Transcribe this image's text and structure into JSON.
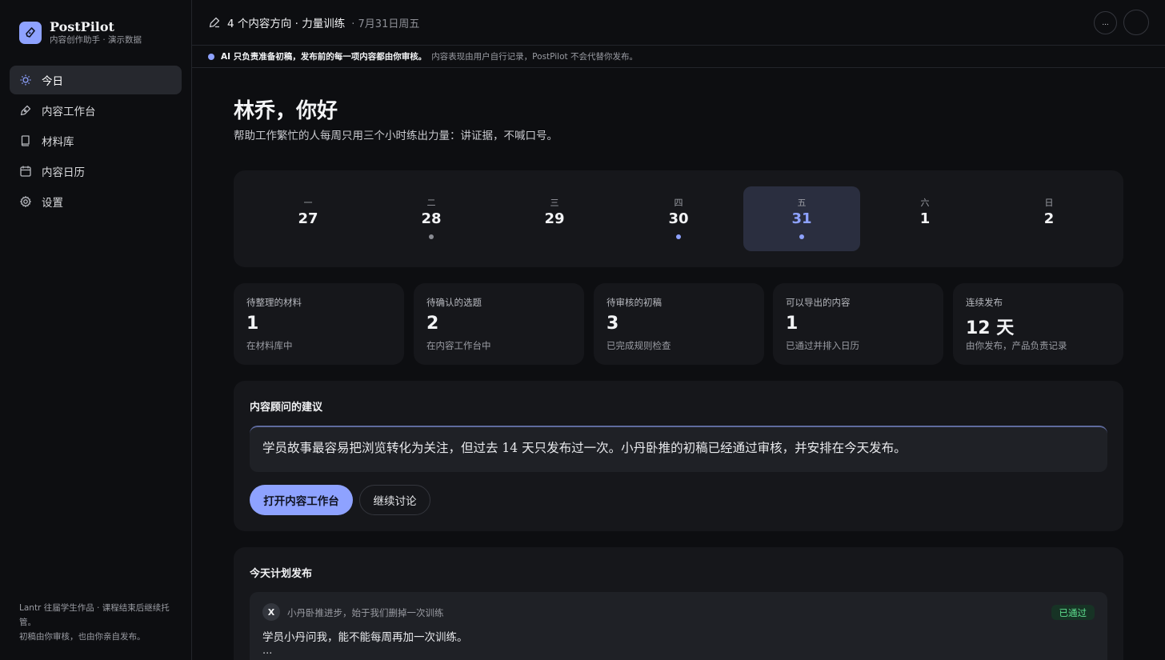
{
  "app": {
    "name": "PostPilot",
    "subtitle": "内容创作助手 · 演示数据"
  },
  "nav": [
    {
      "label": "今日",
      "icon": "sun-icon",
      "active": true
    },
    {
      "label": "内容工作台",
      "icon": "pen-icon",
      "active": false
    },
    {
      "label": "材料库",
      "icon": "book-icon",
      "active": false
    },
    {
      "label": "内容日历",
      "icon": "calendar-icon",
      "active": false
    },
    {
      "label": "设置",
      "icon": "gear-icon",
      "active": false
    }
  ],
  "sidebar_footer": {
    "line1": "Lantr 往届学生作品 · 课程结束后继续托管。",
    "line2": "初稿由你审核，也由你亲自发布。"
  },
  "topbar": {
    "title": "4 个内容方向 · 力量训练",
    "date": "· 7月31日周五",
    "more_label": "..."
  },
  "notice": {
    "strong": "AI 只负责准备初稿，发布前的每一项内容都由你审核。",
    "text": "内容表现由用户自行记录，PostPilot 不会代替你发布。"
  },
  "greeting": "林乔，你好",
  "subtitle": "帮助工作繁忙的人每周只用三个小时练出力量：讲证据，不喊口号。",
  "week": [
    {
      "label": "一",
      "num": "27",
      "dot": null,
      "active": false
    },
    {
      "label": "二",
      "num": "28",
      "dot": "#8a8c93",
      "active": false
    },
    {
      "label": "三",
      "num": "29",
      "dot": null,
      "active": false
    },
    {
      "label": "四",
      "num": "30",
      "dot": "#8ea2ff",
      "active": false
    },
    {
      "label": "五",
      "num": "31",
      "dot": "#8ea2ff",
      "active": true
    },
    {
      "label": "六",
      "num": "1",
      "dot": null,
      "active": false
    },
    {
      "label": "日",
      "num": "2",
      "dot": null,
      "active": false
    }
  ],
  "stats": [
    {
      "label": "待整理的材料",
      "value": "1",
      "desc": "在材料库中"
    },
    {
      "label": "待确认的选题",
      "value": "2",
      "desc": "在内容工作台中"
    },
    {
      "label": "待审核的初稿",
      "value": "3",
      "desc": "已完成规则检查"
    },
    {
      "label": "可以导出的内容",
      "value": "1",
      "desc": "已通过并排入日历"
    },
    {
      "label": "连续发布",
      "value": "12 天",
      "desc": "由你发布，产品负责记录"
    }
  ],
  "advice": {
    "title": "内容顾问的建议",
    "quote": "学员故事最容易把浏览转化为关注，但过去 14 天只发布过一次。小丹卧推的初稿已经通过审核，并安排在今天发布。",
    "primary_button": "打开内容工作台",
    "secondary_button": "继续讨论"
  },
  "schedule": {
    "title": "今天计划发布",
    "post": {
      "avatar": "X",
      "meta": "小丹卧推进步，始于我们删掉一次训练",
      "badge": "已通过",
      "text": "学员小丹问我，能不能每周再加一次训练。",
      "more": "..."
    }
  },
  "colors": {
    "accent": "#8ea2ff",
    "success": "#5ee08f",
    "background": "#0d0e11",
    "card": "#16171b"
  }
}
